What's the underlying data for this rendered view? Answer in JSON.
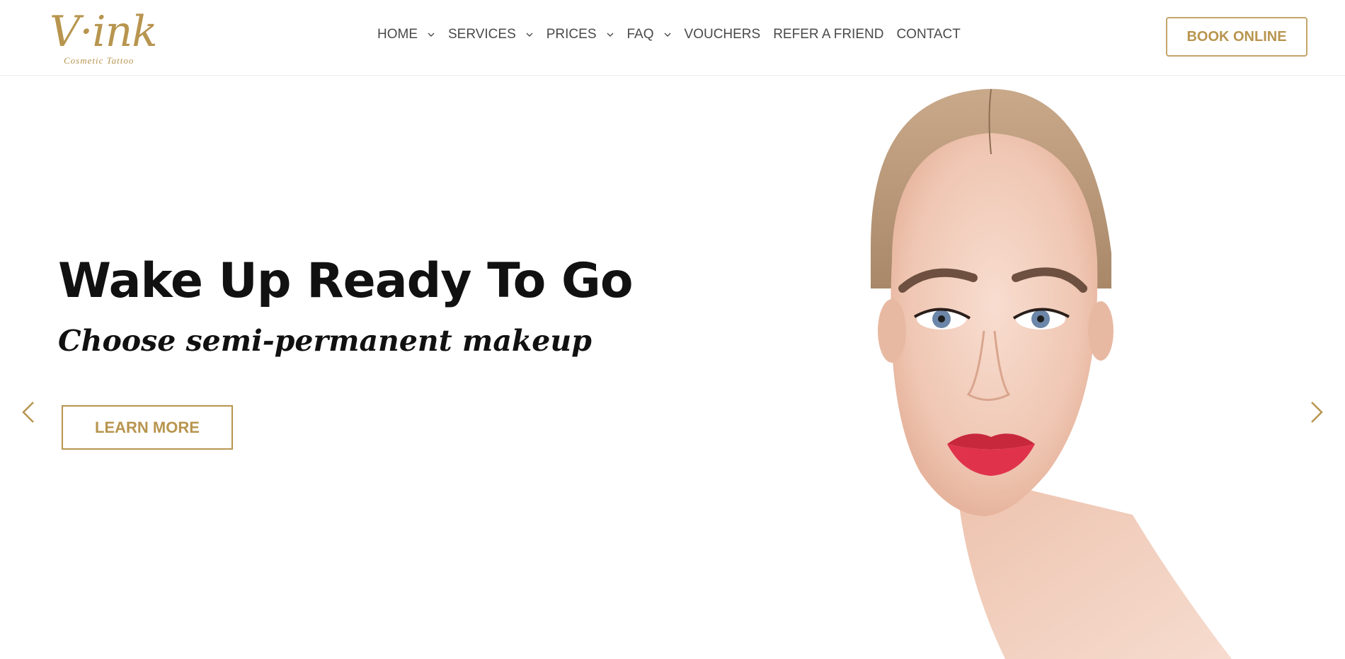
{
  "brand": {
    "logo_text": "V·ink",
    "logo_subtext": "Cosmetic Tattoo",
    "accent_color": "#b8954f"
  },
  "nav": {
    "items": [
      {
        "label": "HOME",
        "has_dropdown": true
      },
      {
        "label": "SERVICES",
        "has_dropdown": true
      },
      {
        "label": "PRICES",
        "has_dropdown": true
      },
      {
        "label": "FAQ",
        "has_dropdown": true
      },
      {
        "label": "VOUCHERS",
        "has_dropdown": false
      },
      {
        "label": "REFER A FRIEND",
        "has_dropdown": false
      },
      {
        "label": "CONTACT",
        "has_dropdown": false
      }
    ]
  },
  "header": {
    "cta_label": "BOOK ONLINE"
  },
  "hero": {
    "headline": "Wake Up Ready To Go",
    "subheadline": "Choose semi-permanent makeup",
    "button_label": "LEARN MORE",
    "prev_icon": "chevron-left-icon",
    "next_icon": "chevron-right-icon"
  }
}
